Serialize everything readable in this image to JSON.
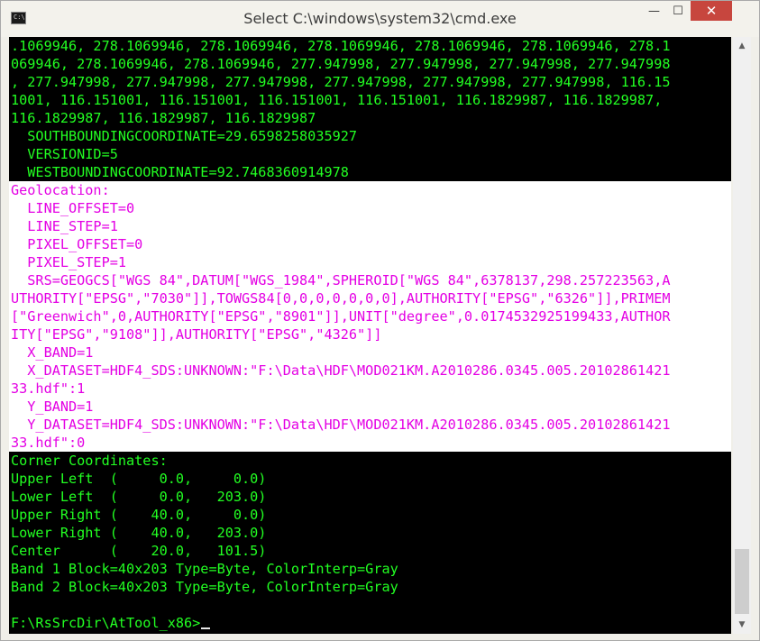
{
  "window": {
    "title": "Select C:\\windows\\system32\\cmd.exe",
    "icon_name": "cmd-icon",
    "icon_text": "C:\\",
    "controls": {
      "minimize": "—",
      "maximize": "☐",
      "close": "✕"
    }
  },
  "colors": {
    "console_bg": "#000000",
    "green_text": "#22ff22",
    "magenta_text": "#e400e4",
    "selection_bg": "#ffffff",
    "close_button": "#c7463e"
  },
  "console": {
    "lines": [
      ".1069946, 278.1069946, 278.1069946, 278.1069946, 278.1069946, 278.1069946, 278.1",
      "069946, 278.1069946, 278.1069946, 277.947998, 277.947998, 277.947998, 277.947998",
      ", 277.947998, 277.947998, 277.947998, 277.947998, 277.947998, 277.947998, 116.15",
      "1001, 116.151001, 116.151001, 116.151001, 116.151001, 116.1829987, 116.1829987,",
      "116.1829987, 116.1829987, 116.1829987",
      "  SOUTHBOUNDINGCOORDINATE=29.6598258035927",
      "  VERSIONID=5",
      "  WESTBOUNDINGCOORDINATE=92.7468360914978",
      "Geolocation:",
      "  LINE_OFFSET=0",
      "  LINE_STEP=1",
      "  PIXEL_OFFSET=0",
      "  PIXEL_STEP=1",
      "  SRS=GEOGCS[\"WGS 84\",DATUM[\"WGS_1984\",SPHEROID[\"WGS 84\",6378137,298.257223563,A",
      "UTHORITY[\"EPSG\",\"7030\"]],TOWGS84[0,0,0,0,0,0,0],AUTHORITY[\"EPSG\",\"6326\"]],PRIMEM",
      "[\"Greenwich\",0,AUTHORITY[\"EPSG\",\"8901\"]],UNIT[\"degree\",0.0174532925199433,AUTHOR",
      "ITY[\"EPSG\",\"9108\"]],AUTHORITY[\"EPSG\",\"4326\"]]",
      "  X_BAND=1",
      "  X_DATASET=HDF4_SDS:UNKNOWN:\"F:\\Data\\HDF\\MOD021KM.A2010286.0345.005.20102861421",
      "33.hdf\":1",
      "  Y_BAND=1",
      "  Y_DATASET=HDF4_SDS:UNKNOWN:\"F:\\Data\\HDF\\MOD021KM.A2010286.0345.005.20102861421",
      "33.hdf\":0",
      "Corner Coordinates:",
      "Upper Left  (     0.0,     0.0)",
      "Lower Left  (     0.0,   203.0)",
      "Upper Right (    40.0,     0.0)",
      "Lower Right (    40.0,   203.0)",
      "Center      (    20.0,   101.5)",
      "Band 1 Block=40x203 Type=Byte, ColorInterp=Gray",
      "Band 2 Block=40x203 Type=Byte, ColorInterp=Gray",
      "",
      "F:\\RsSrcDir\\AtTool_x86>"
    ]
  },
  "scrollbar": {
    "up_icon": "▲",
    "down_icon": "▼"
  }
}
